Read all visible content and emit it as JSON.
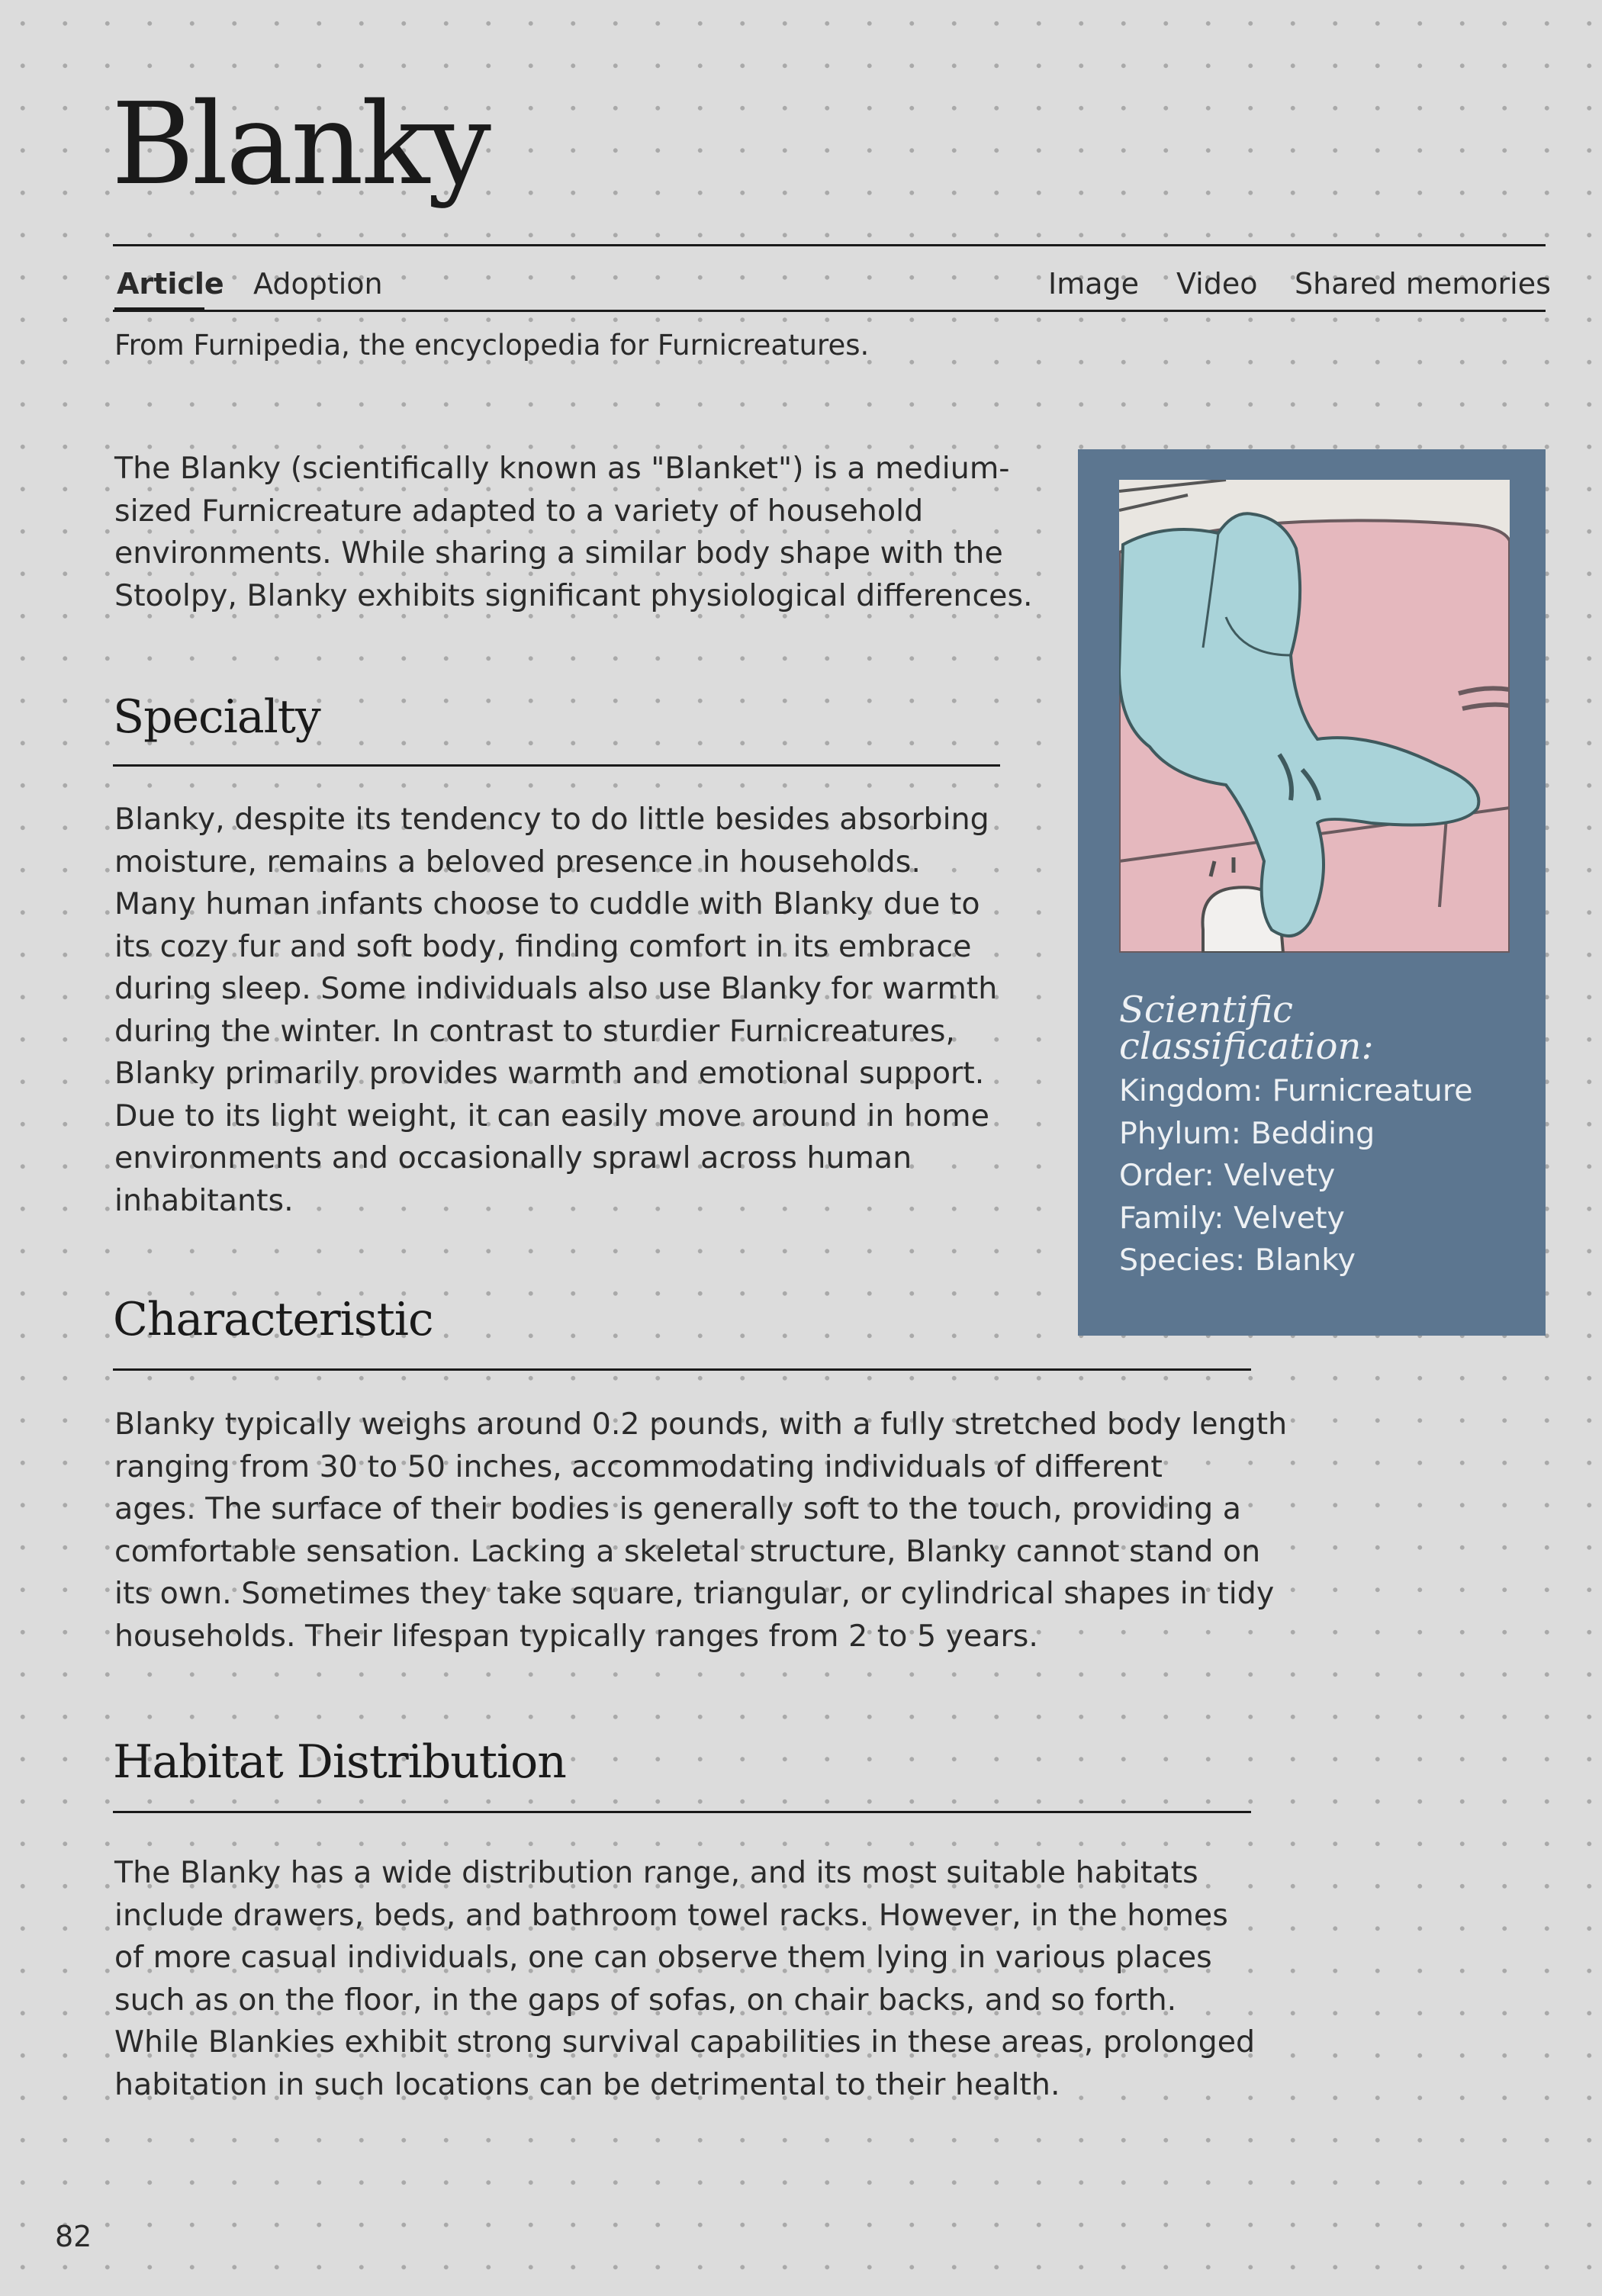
{
  "title": "Blanky",
  "tabs": {
    "article": "Article",
    "adoption": "Adoption",
    "image": "Image",
    "video": "Video",
    "shared_memories": "Shared memories"
  },
  "source_line": "From Furnipedia, the encyclopedia for Furnicreatures.",
  "intro": [
    "The Blanky (scientifically known as \"Blanket\") is a medium-",
    "sized Furnicreature adapted to a variety of household",
    "environments. While sharing a similar body shape with the",
    "Stoolpy, Blanky exhibits significant physiological differences."
  ],
  "sections": [
    {
      "heading": "Specialty",
      "lines": [
        "Blanky, despite its tendency to do little besides absorbing",
        "moisture, remains a beloved presence in households.",
        "Many human infants choose to cuddle with Blanky due to",
        "its cozy fur and soft body, finding comfort in its embrace",
        "during sleep. Some individuals also use Blanky for warmth",
        "during the winter. In contrast to sturdier Furnicreatures,",
        "Blanky primarily provides warmth and emotional support.",
        "Due to its light weight, it can easily move around in home",
        "environments and occasionally sprawl across human",
        "inhabitants."
      ]
    },
    {
      "heading": "Characteristic",
      "lines": [
        "Blanky typically weighs around 0.2 pounds, with a fully stretched body length",
        "ranging from 30 to 50 inches, accommodating individuals of different",
        "ages. The surface of their bodies is generally soft to the touch, providing a",
        "comfortable sensation. Lacking a skeletal structure, Blanky cannot stand on",
        "its own. Sometimes they take square, triangular, or cylindrical shapes in tidy",
        "households. Their lifespan typically ranges from 2 to 5 years."
      ]
    },
    {
      "heading": "Habitat Distribution",
      "lines": [
        "The Blanky has a wide distribution range, and its most suitable habitats",
        "include drawers, beds, and bathroom towel racks. However, in the homes",
        "of more casual individuals, one can observe them lying in various places",
        "such as on the floor, in the gaps of sofas, on chair backs, and so forth.",
        "While Blankies exhibit strong survival capabilities in these areas, prolonged",
        "habitation in such locations can be detrimental to their health."
      ]
    }
  ],
  "classification": {
    "heading": "Scientific classification:",
    "items": [
      "Kingdom: Furnicreature",
      "Phylum: Bedding",
      "Order: Velvety",
      "Family: Velvety",
      "Species: Blanky"
    ]
  },
  "page_number": "82",
  "colors": {
    "page_background": "#dcdcdc",
    "dot_grid": "#a9a9a9",
    "panel": "#5c7690",
    "blanky_body": "#a9d3d9",
    "sofa": "#e5b8be",
    "ink": "#1a1a1a"
  }
}
